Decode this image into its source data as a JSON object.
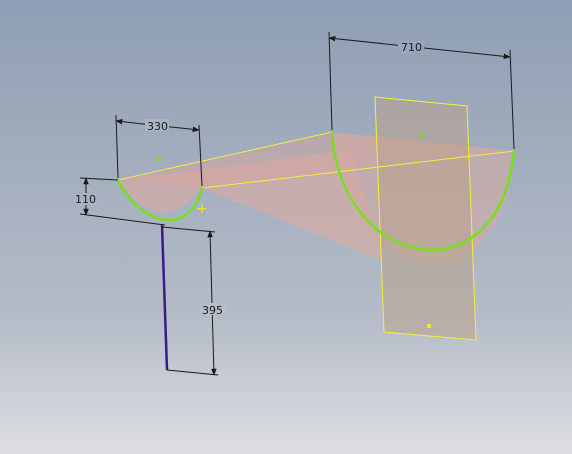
{
  "viewport": {
    "background_top": "#8f9eb4",
    "background_bottom": "#dcdee2"
  },
  "dimensions": {
    "small_width": "330",
    "small_depth": "110",
    "large_width": "710",
    "vertical_length": "395"
  },
  "colors": {
    "sketch_green": "#76e01c",
    "sketch_yellow": "#f2ef3a",
    "surface_pink": "#e2a99f",
    "plane_fill": "#c8ab8e",
    "dimension_line": "#1a1a1a",
    "path_line": "#3b1a8a",
    "point_yellow": "#f2e81a"
  }
}
